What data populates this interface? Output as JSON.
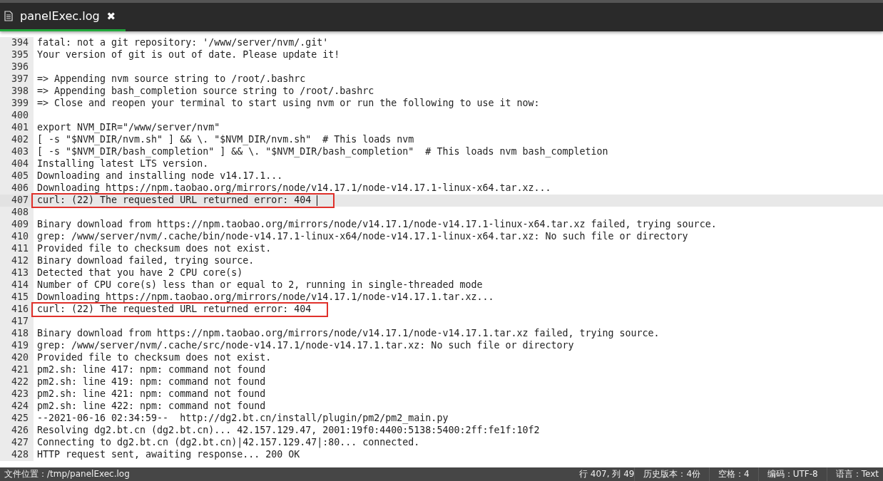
{
  "tab": {
    "title": "panelExec.log",
    "selected": true,
    "close": "✖"
  },
  "lines": [
    {
      "number": "394",
      "text": "fatal: not a git repository: '/www/server/nvm/.git'",
      "current": false,
      "boxed": false
    },
    {
      "number": "395",
      "text": "Your version of git is out of date. Please update it!",
      "current": false,
      "boxed": false
    },
    {
      "number": "396",
      "current": false,
      "boxed": false
    },
    {
      "number": "397",
      "text": "=> Appending nvm source string to /root/.bashrc",
      "current": false,
      "boxed": false
    },
    {
      "number": "398",
      "text": "=> Appending bash_completion source string to /root/.bashrc",
      "current": false,
      "boxed": false
    },
    {
      "number": "399",
      "text": "=> Close and reopen your terminal to start using nvm or run the following to use it now:",
      "current": false,
      "boxed": false
    },
    {
      "number": "400",
      "current": false,
      "boxed": false
    },
    {
      "number": "401",
      "text": "export NVM_DIR=\"/www/server/nvm\"",
      "current": false,
      "boxed": false
    },
    {
      "number": "402",
      "text": "[ -s \"$NVM_DIR/nvm.sh\" ] && \\. \"$NVM_DIR/nvm.sh\"  # This loads nvm",
      "current": false,
      "boxed": false
    },
    {
      "number": "403",
      "text": "[ -s \"$NVM_DIR/bash_completion\" ] && \\. \"$NVM_DIR/bash_completion\"  # This loads nvm bash_completion",
      "current": false,
      "boxed": false
    },
    {
      "number": "404",
      "text": "Installing latest LTS version.",
      "current": false,
      "boxed": false
    },
    {
      "number": "405",
      "text": "Downloading and installing node v14.17.1...",
      "current": false,
      "boxed": false
    },
    {
      "number": "406",
      "text": "Downloading https://npm.taobao.org/mirrors/node/v14.17.1/node-v14.17.1-linux-x64.tar.xz...",
      "current": false,
      "boxed": false
    },
    {
      "number": "407",
      "text": "curl: (22) The requested URL returned error: 404",
      "current": true,
      "boxed": true
    },
    {
      "number": "408",
      "current": false,
      "boxed": false
    },
    {
      "number": "409",
      "text": "Binary download from https://npm.taobao.org/mirrors/node/v14.17.1/node-v14.17.1-linux-x64.tar.xz failed, trying source.",
      "current": false,
      "boxed": false
    },
    {
      "number": "410",
      "text": "grep: /www/server/nvm/.cache/bin/node-v14.17.1-linux-x64/node-v14.17.1-linux-x64.tar.xz: No such file or directory",
      "current": false,
      "boxed": false
    },
    {
      "number": "411",
      "text": "Provided file to checksum does not exist.",
      "current": false,
      "boxed": false
    },
    {
      "number": "412",
      "text": "Binary download failed, trying source.",
      "current": false,
      "boxed": false
    },
    {
      "number": "413",
      "text": "Detected that you have 2 CPU core(s)",
      "current": false,
      "boxed": false
    },
    {
      "number": "414",
      "text": "Number of CPU core(s) less than or equal to 2, running in single-threaded mode",
      "current": false,
      "boxed": false
    },
    {
      "number": "415",
      "text": "Downloading https://npm.taobao.org/mirrors/node/v14.17.1/node-v14.17.1.tar.xz...",
      "current": false,
      "boxed": false
    },
    {
      "number": "416",
      "text": "curl: (22) The requested URL returned error: 404",
      "current": false,
      "boxed": true
    },
    {
      "number": "417",
      "current": false,
      "boxed": false
    },
    {
      "number": "418",
      "text": "Binary download from https://npm.taobao.org/mirrors/node/v14.17.1/node-v14.17.1.tar.xz failed, trying source.",
      "current": false,
      "boxed": false
    },
    {
      "number": "419",
      "text": "grep: /www/server/nvm/.cache/src/node-v14.17.1/node-v14.17.1.tar.xz: No such file or directory",
      "current": false,
      "boxed": false
    },
    {
      "number": "420",
      "text": "Provided file to checksum does not exist.",
      "current": false,
      "boxed": false
    },
    {
      "number": "421",
      "text": "pm2.sh: line 417: npm: command not found",
      "current": false,
      "boxed": false
    },
    {
      "number": "422",
      "text": "pm2.sh: line 419: npm: command not found",
      "current": false,
      "boxed": false
    },
    {
      "number": "423",
      "text": "pm2.sh: line 421: npm: command not found",
      "current": false,
      "boxed": false
    },
    {
      "number": "424",
      "text": "pm2.sh: line 422: npm: command not found",
      "current": false,
      "boxed": false
    },
    {
      "number": "425",
      "text": "--2021-06-16 02:34:59--  http://dg2.bt.cn/install/plugin/pm2/pm2_main.py",
      "current": false,
      "boxed": false
    },
    {
      "number": "426",
      "text": "Resolving dg2.bt.cn (dg2.bt.cn)... 42.157.129.47, 2001:19f0:4400:5138:5400:2ff:fe1f:10f2",
      "current": false,
      "boxed": false
    },
    {
      "number": "427",
      "text": "Connecting to dg2.bt.cn (dg2.bt.cn)|42.157.129.47|:80... connected.",
      "current": false,
      "boxed": false
    },
    {
      "number": "428",
      "text": "HTTP request sent, awaiting response... 200 OK",
      "current": false,
      "boxed": false
    }
  ],
  "status_bar": {
    "file_location": "文件位置：/tmp/panelExec.log",
    "cursor": "行 407, 列 49",
    "history": "历史版本：4份",
    "indent": "空格：4",
    "encoding": "编码：UTF-8",
    "language": "语言：Text"
  }
}
